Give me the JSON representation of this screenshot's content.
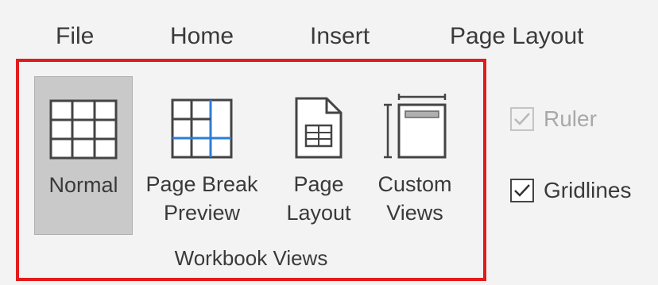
{
  "ribbon_tabs": {
    "file": "File",
    "home": "Home",
    "insert": "Insert",
    "page_layout": "Page Layout"
  },
  "workbook_views": {
    "group_label": "Workbook Views",
    "buttons": [
      {
        "label": "Normal",
        "icon": "normal-view-icon",
        "selected": true
      },
      {
        "label": "Page Break\nPreview",
        "icon": "page-break-preview-icon",
        "selected": false
      },
      {
        "label": "Page\nLayout",
        "icon": "page-layout-view-icon",
        "selected": false
      },
      {
        "label": "Custom\nViews",
        "icon": "custom-views-icon",
        "selected": false
      }
    ],
    "highlight_color": "#e21b1b"
  },
  "show_options": {
    "ruler": {
      "label": "Ruler",
      "checked": true,
      "enabled": false
    },
    "gridlines": {
      "label": "Gridlines",
      "checked": true,
      "enabled": true
    }
  }
}
